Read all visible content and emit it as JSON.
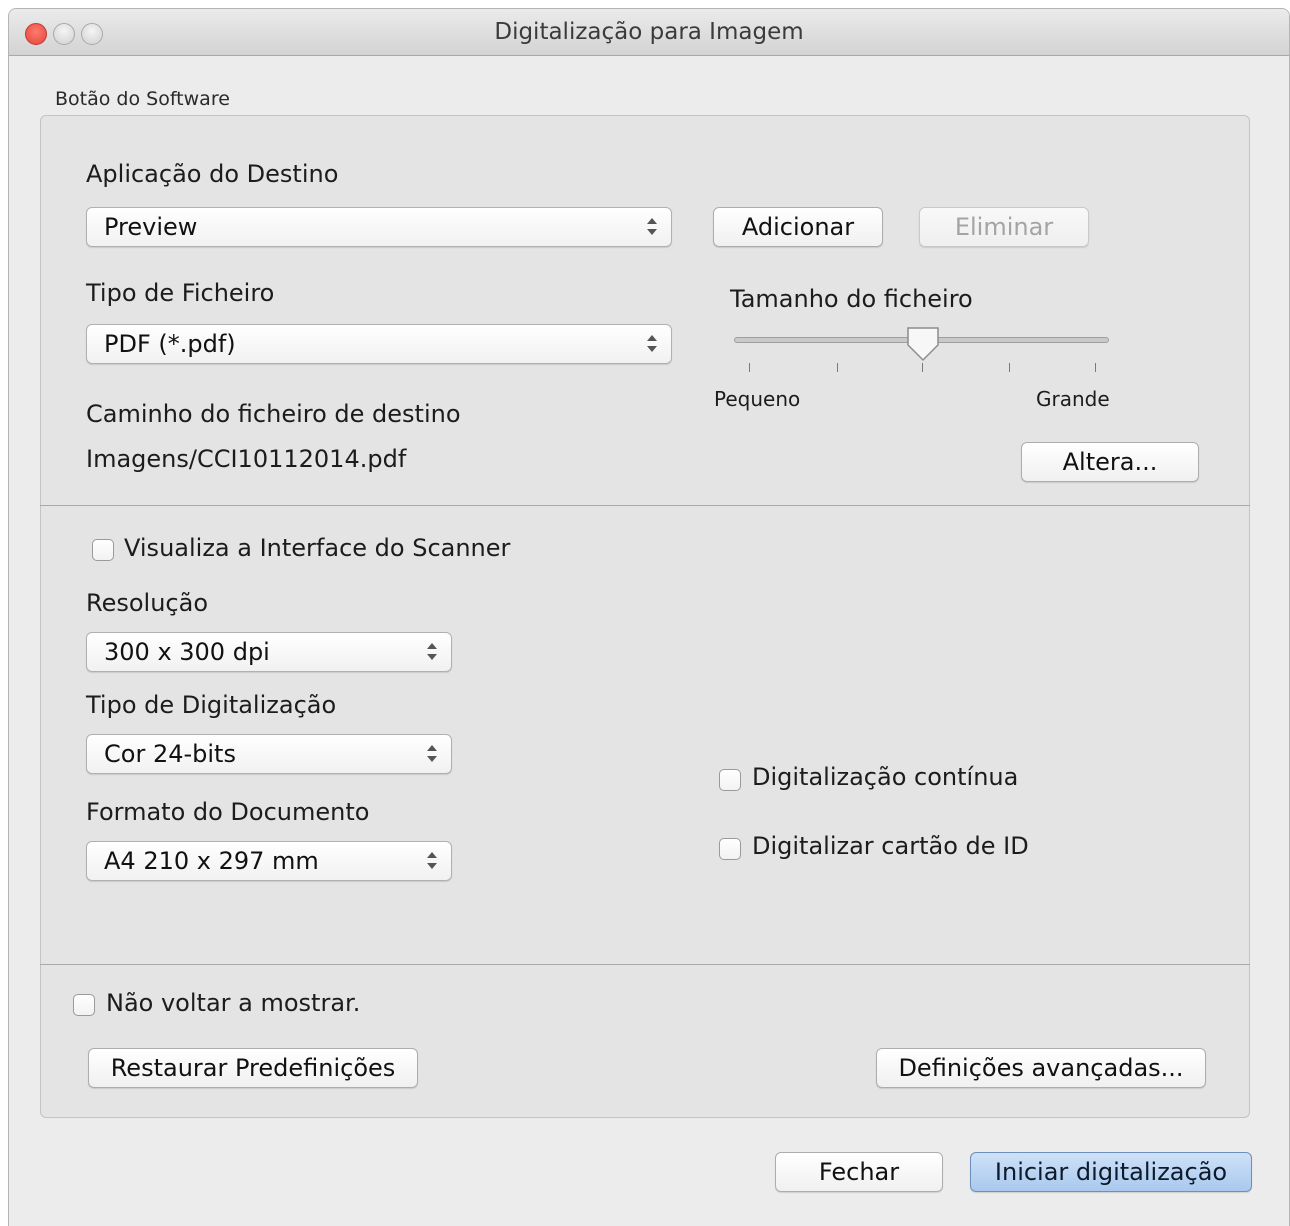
{
  "window": {
    "title": "Digitalização para Imagem"
  },
  "section": {
    "label": "Botão do Software"
  },
  "destination": {
    "label": "Aplicação do Destino",
    "selected": "Preview",
    "add_label": "Adicionar",
    "delete_label": "Eliminar"
  },
  "filetype": {
    "label": "Tipo de Ficheiro",
    "selected": "PDF (*.pdf)"
  },
  "filesize": {
    "label": "Tamanho do ficheiro",
    "min_label": "Pequeno",
    "max_label": "Grande",
    "level": 0.5
  },
  "path": {
    "label": "Caminho do ficheiro de destino",
    "value": "Imagens/CCI10112014.pdf",
    "change_label": "Altera..."
  },
  "scanner_ui": {
    "label": "Visualiza a Interface do Scanner",
    "checked": false
  },
  "resolution": {
    "label": "Resolução",
    "selected": "300 x 300 dpi"
  },
  "scan_type": {
    "label": "Tipo de Digitalização",
    "selected": "Cor 24-bits"
  },
  "doc_size": {
    "label": "Formato do Documento",
    "selected": "A4 210 x 297 mm"
  },
  "continuous": {
    "label": "Digitalização contínua",
    "checked": false
  },
  "id_card": {
    "label": "Digitalizar cartão de ID",
    "checked": false
  },
  "dont_show": {
    "label": "Não voltar a mostrar.",
    "checked": false
  },
  "footer": {
    "restore_label": "Restaurar Predefinições",
    "advanced_label": "Definições avançadas...",
    "close_label": "Fechar",
    "start_label": "Iniciar digitalização"
  }
}
